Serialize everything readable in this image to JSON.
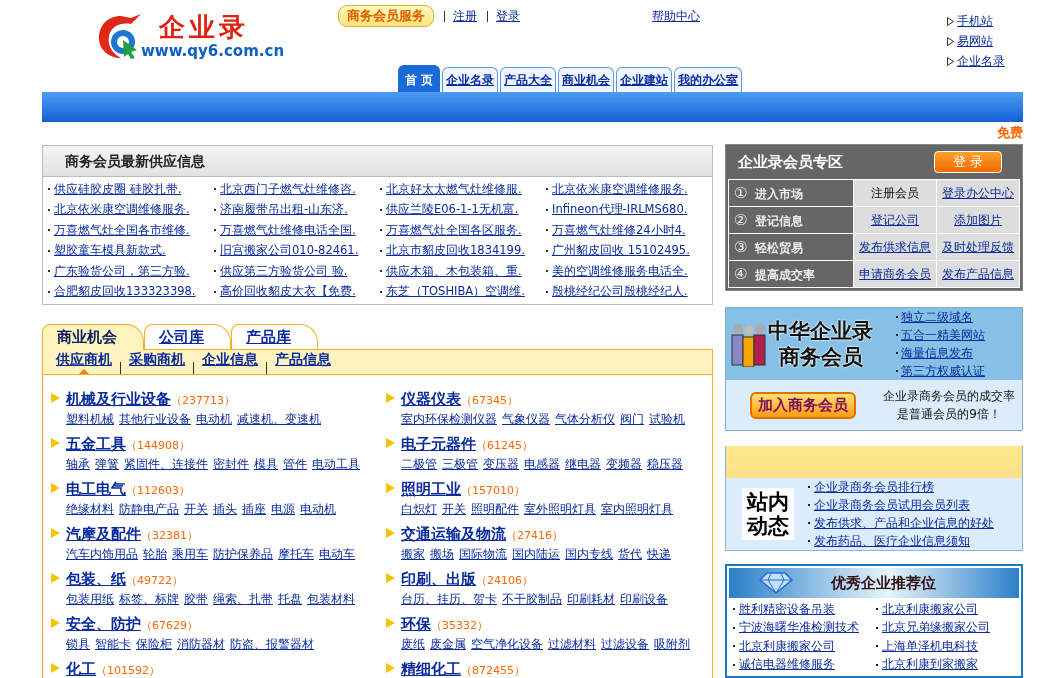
{
  "header": {
    "logo": {
      "name": "企业录",
      "url": "www.qy6.com.cn"
    },
    "service_button": "商务会员服务",
    "top_links": [
      "注册",
      "登录"
    ],
    "help_link": "帮助中心",
    "side_links": [
      "手机站",
      "易网站",
      "企业名录"
    ],
    "nav_tabs": [
      {
        "label": "首 页",
        "selected": true
      },
      {
        "label": "企业名录",
        "selected": false
      },
      {
        "label": "产品大全",
        "selected": false
      },
      {
        "label": "商业机会",
        "selected": false
      },
      {
        "label": "企业建站",
        "selected": false
      },
      {
        "label": "我的办公室",
        "selected": false
      }
    ],
    "free_link": "免费"
  },
  "supply_info": {
    "title": "商务会员最新供应信息",
    "items": [
      "供应硅胶皮圈 硅胶扎带.",
      "北京西门子燃气灶维修咨.",
      "北京好太太燃气灶维修服.",
      "北京依米康空调维修服务.",
      "北京依米康空调维修服务.",
      "济南履带吊出租-山东济.",
      "供应兰陵E06-1-1无机富.",
      "Infineon代理-IRLMS680.",
      "万喜燃气灶全国各市维修.",
      "万喜燃气灶维修电话全国.",
      "万喜燃气灶全国各区服务.",
      "万喜燃气灶维修24小时4.",
      "塑胶童车模具新款式.",
      "旧宫搬家公司010-82461.",
      "北京市貂皮回收1834199.",
      "广州貂皮回收 15102495.",
      "广东验货公司，第三方验.",
      "供应第三方验货公司 验.",
      "供应木箱、木包装箱、重.",
      "美的空调维修服务电话全.",
      "合肥貂皮回收133323398.",
      "高价回收貂皮大衣【免费.",
      "东芝（TOSHIBA）空调维.",
      "殷桃经纪公司殷桃经纪人."
    ]
  },
  "member_zone": {
    "title": "企业录会员专区",
    "login_button": "登 录",
    "steps": [
      {
        "number": "①",
        "label": "进入市场",
        "actions": [
          {
            "text": "注册会员",
            "kind": "plain"
          },
          {
            "text": "登录办公中心",
            "kind": "link"
          }
        ]
      },
      {
        "number": "②",
        "label": "登记信息",
        "actions": [
          {
            "text": "登记公司",
            "kind": "link"
          },
          {
            "text": "添加图片",
            "kind": "link"
          }
        ]
      },
      {
        "number": "③",
        "label": "轻松贸易",
        "actions": [
          {
            "text": "发布供求信息",
            "kind": "link"
          },
          {
            "text": "及时处理反馈",
            "kind": "link"
          }
        ]
      },
      {
        "number": "④",
        "label": "提高成交率",
        "actions": [
          {
            "text": "申请商务会员",
            "kind": "link"
          },
          {
            "text": "发布产品信息",
            "kind": "link"
          }
        ]
      }
    ]
  },
  "categories": {
    "tabs": [
      {
        "label": "商业机会",
        "selected": true
      },
      {
        "label": "公司库",
        "selected": false
      },
      {
        "label": "产品库",
        "selected": false
      }
    ],
    "subtabs": [
      {
        "label": "供应商机",
        "selected": true
      },
      {
        "label": "采购商机",
        "selected": false
      },
      {
        "label": "企业信息",
        "selected": false
      },
      {
        "label": "产品信息",
        "selected": false
      }
    ],
    "items": [
      {
        "title": "机械及行业设备",
        "count": "（237713）",
        "subs": [
          "塑料机械",
          "其他行业设备",
          "电动机",
          "减速机、变速机"
        ]
      },
      {
        "title": "仪器仪表",
        "count": "（67345）",
        "subs": [
          "室内环保检测仪器",
          "气象仪器",
          "气体分析仪",
          "阀门",
          "试验机"
        ]
      },
      {
        "title": "五金工具",
        "count": "（144908）",
        "subs": [
          "轴承",
          "弹簧",
          "紧固件、连接件",
          "密封件",
          "模具",
          "管件",
          "电动工具"
        ]
      },
      {
        "title": "电子元器件",
        "count": "（61245）",
        "subs": [
          "二极管",
          "三极管",
          "变压器",
          "电感器",
          "继电器",
          "变频器",
          "稳压器"
        ]
      },
      {
        "title": "电工电气",
        "count": "（112603）",
        "subs": [
          "绝缘材料",
          "防静电产品",
          "开关",
          "插头",
          "插座",
          "电源",
          "电动机"
        ]
      },
      {
        "title": "照明工业",
        "count": "（157010）",
        "subs": [
          "白炽灯",
          "开关",
          "照明配件",
          "室外照明灯具",
          "室内照明灯具"
        ]
      },
      {
        "title": "汽摩及配件",
        "count": "（32381）",
        "subs": [
          "汽车内饰用品",
          "轮胎",
          "乘用车",
          "防护保养品",
          "摩托车",
          "电动车"
        ]
      },
      {
        "title": "交通运输及物流",
        "count": "（27416）",
        "subs": [
          "搬家",
          "搬场",
          "国际物流",
          "国内陆运",
          "国内专线",
          "货代",
          "快递"
        ]
      },
      {
        "title": "包装、纸",
        "count": "（49722）",
        "subs": [
          "包装用纸",
          "标签、标牌",
          "胶带",
          "绳索、扎带",
          "托盘",
          "包装材料"
        ]
      },
      {
        "title": "印刷、出版",
        "count": "（24106）",
        "subs": [
          "台历、挂历、贺卡",
          "不干胶制品",
          "印刷耗材",
          "印刷设备"
        ]
      },
      {
        "title": "安全、防护",
        "count": "（67629）",
        "subs": [
          "锁具",
          "智能卡",
          "保险柜",
          "消防器材",
          "防盗、报警器材"
        ]
      },
      {
        "title": "环保",
        "count": "（35332）",
        "subs": [
          "废纸",
          "废金属",
          "空气净化设备",
          "过滤材料",
          "过滤设备",
          "吸附剂"
        ]
      },
      {
        "title": "化工",
        "count": "（101592）"
      },
      {
        "title": "精细化工",
        "count": "（872455）"
      }
    ]
  },
  "membership_ad": {
    "banner_title": "中华企业录",
    "banner_subtitle": "商务会员",
    "features": [
      "独立二级域名",
      "五合一精美网站",
      "海量信息发布",
      "第三方权威认证"
    ],
    "join_button": "加入商务会员",
    "note": "企业录商务会员的成交率是普通会员的9倍！"
  },
  "site_news": {
    "label": "站内动态",
    "links": [
      "企业录商务会员排行榜",
      "企业录商务会员试用会员列表",
      "发布供求、产品和企业信息的好处",
      "发布药品、医疗企业信息须知"
    ]
  },
  "recommended": {
    "title": "优秀企业推荐位",
    "companies": [
      "胜利精密设备吊装",
      "北京利康搬家公司",
      "宁波海曙华准检测技术",
      "北京兄弟缘搬家公司",
      "北京利康搬家公司",
      "上海单泽机电科技",
      "诚信电器维修服务",
      "北京利康到家搬家"
    ]
  }
}
